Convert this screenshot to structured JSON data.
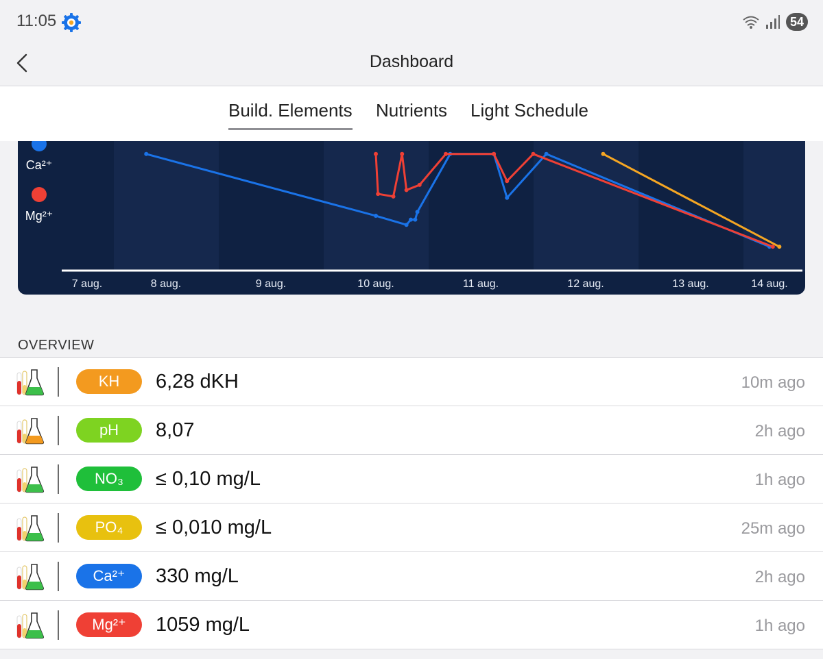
{
  "status_bar": {
    "time": "11:05",
    "battery": "54"
  },
  "header": {
    "title": "Dashboard"
  },
  "tabs": [
    {
      "label": "Build. Elements",
      "active": true
    },
    {
      "label": "Nutrients",
      "active": false
    },
    {
      "label": "Light Schedule",
      "active": false
    }
  ],
  "chart_data": {
    "type": "line",
    "legend": [
      {
        "name": "Ca²⁺",
        "color": "#1a73e8"
      },
      {
        "name": "Mg²⁺",
        "color": "#ef4035"
      }
    ],
    "x_ticks": [
      "7 aug.",
      "8 aug.",
      "9 aug.",
      "10 aug.",
      "11 aug.",
      "12 aug.",
      "13 aug.",
      "14 aug."
    ],
    "series": [
      {
        "name": "Ca²⁺",
        "color": "#1a73e8",
        "points": [
          [
            "7 aug. 18:00",
            9.0
          ],
          [
            "10 aug. 00:00",
            4.2
          ],
          [
            "10 aug. 07:00",
            3.5
          ],
          [
            "10 aug. 08:00",
            3.9
          ],
          [
            "10 aug. 09:00",
            3.9
          ],
          [
            "10 aug. 09:30",
            4.5
          ],
          [
            "10 aug. 17:00",
            9.0
          ],
          [
            "11 aug. 03:00",
            9.0
          ],
          [
            "11 aug. 06:00",
            5.6
          ],
          [
            "11 aug. 15:00",
            9.0
          ],
          [
            "14 aug. 00:00",
            1.8
          ]
        ]
      },
      {
        "name": "Mg²⁺",
        "color": "#ef4035",
        "points": [
          [
            "10 aug. 00:00",
            9.0
          ],
          [
            "10 aug. 00:30",
            5.9
          ],
          [
            "10 aug. 04:00",
            5.7
          ],
          [
            "10 aug. 06:00",
            9.0
          ],
          [
            "10 aug. 07:00",
            6.2
          ],
          [
            "10 aug. 10:00",
            6.6
          ],
          [
            "10 aug. 16:00",
            9.0
          ],
          [
            "11 aug. 03:00",
            9.0
          ],
          [
            "11 aug. 06:00",
            6.9
          ],
          [
            "11 aug. 12:00",
            9.0
          ],
          [
            "14 aug. 01:00",
            1.8
          ]
        ]
      },
      {
        "color": "#f5a623",
        "points": [
          [
            "12 aug. 04:00",
            9.0
          ],
          [
            "14 aug. 03:00",
            1.8
          ]
        ]
      }
    ]
  },
  "overview": {
    "label": "OVERVIEW",
    "items": [
      {
        "name": "KH",
        "color": "#f39a1f",
        "liquid": "#3cbf4a",
        "value": "6,28 dKH",
        "ago": "10m ago"
      },
      {
        "name": "pH",
        "color": "#7ed321",
        "liquid": "#f39a1f",
        "value": "8,07",
        "ago": "2h ago"
      },
      {
        "name": "NO₃",
        "color": "#1fbf3a",
        "liquid": "#3cbf4a",
        "value": "≤ 0,10 mg/L",
        "ago": "1h ago"
      },
      {
        "name": "PO₄",
        "color": "#e8c10f",
        "liquid": "#3cbf4a",
        "value": "≤ 0,010 mg/L",
        "ago": "25m ago"
      },
      {
        "name": "Ca²⁺",
        "color": "#1a73e8",
        "liquid": "#3cbf4a",
        "value": "330 mg/L",
        "ago": "2h ago"
      },
      {
        "name": "Mg²⁺",
        "color": "#ef4035",
        "liquid": "#3cbf4a",
        "value": "1059 mg/L",
        "ago": "1h ago"
      }
    ]
  }
}
